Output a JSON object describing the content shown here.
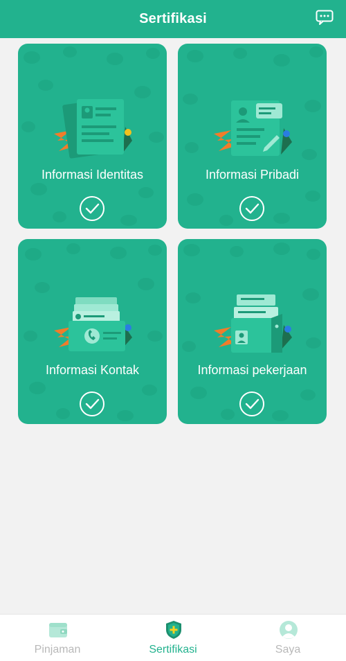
{
  "header": {
    "title": "Sertifikasi",
    "chat_icon": "chat-bubble-icon"
  },
  "cards": [
    {
      "label": "Informasi Identitas",
      "icon": "id-card-icon",
      "status": "completed"
    },
    {
      "label": "Informasi Pribadi",
      "icon": "personal-document-icon",
      "status": "completed"
    },
    {
      "label": "Informasi Kontak",
      "icon": "contact-cards-icon",
      "status": "completed"
    },
    {
      "label": "Informasi pekerjaan",
      "icon": "job-folder-icon",
      "status": "completed"
    }
  ],
  "nav": {
    "items": [
      {
        "label": "Pinjaman",
        "icon": "wallet-icon",
        "active": false
      },
      {
        "label": "Sertifikasi",
        "icon": "shield-plus-icon",
        "active": true
      },
      {
        "label": "Saya",
        "icon": "user-avatar-icon",
        "active": false
      }
    ]
  },
  "colors": {
    "primary": "#22b28e",
    "inactive": "#b8b8b8",
    "background": "#f2f2f2"
  }
}
